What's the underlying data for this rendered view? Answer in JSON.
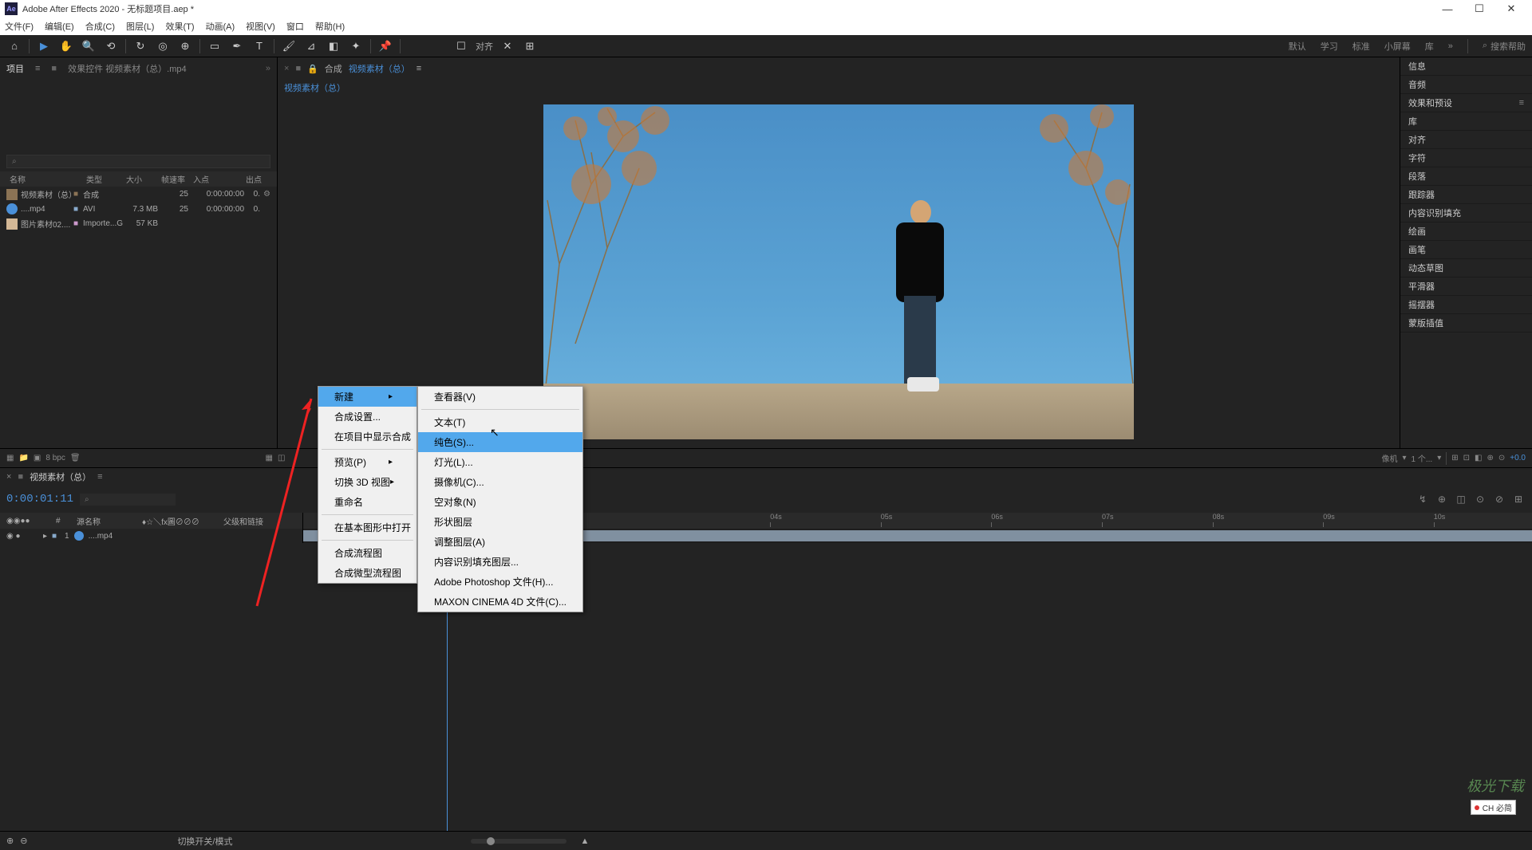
{
  "title": "Adobe After Effects 2020 - 无标题项目.aep *",
  "menu_bar": [
    "文件(F)",
    "编辑(E)",
    "合成(C)",
    "图层(L)",
    "效果(T)",
    "动画(A)",
    "视图(V)",
    "窗口",
    "帮助(H)"
  ],
  "toolbar": {
    "align_label": "对齐",
    "workspaces": [
      "默认",
      "学习",
      "标准",
      "小屏幕",
      "库"
    ],
    "search_placeholder": "搜索帮助"
  },
  "project": {
    "tab_project": "项目",
    "tab_effects": "效果控件 视频素材（总）.mp4",
    "search_icon": "⌕",
    "headers": {
      "name": "名称",
      "type": "类型",
      "size": "大小",
      "fps": "帧速率",
      "in": "入点",
      "out": "出点"
    },
    "rows": [
      {
        "name": "视频素材（总）",
        "type": "合成",
        "size": "",
        "fps": "25",
        "in": "0:00:00:00",
        "out": "0."
      },
      {
        "name": "....mp4",
        "type": "AVI",
        "size": "7.3 MB",
        "fps": "25",
        "in": "0:00:00:00",
        "out": "0."
      },
      {
        "name": "图片素材02....",
        "type": "Importe...G",
        "size": "57 KB",
        "fps": "",
        "in": "",
        "out": ""
      }
    ],
    "footer_bpc": "8 bpc"
  },
  "comp": {
    "label": "合成",
    "name": "视频素材（总）",
    "crumb": "视频素材（总）",
    "bottom": {
      "camera": "像机",
      "one": "1 个...",
      "val": "+0.0"
    }
  },
  "right_panels": [
    "信息",
    "音频",
    "效果和预设",
    "库",
    "对齐",
    "字符",
    "段落",
    "跟踪器",
    "内容识别填充",
    "绘画",
    "画笔",
    "动态草图",
    "平滑器",
    "摇摆器",
    "蒙版插值"
  ],
  "timeline": {
    "name": "视频素材（总）",
    "timecode": "0:00:01:11",
    "header_left": [
      "#",
      "源名称",
      "♦☆＼fx圖⊘⊘⊘",
      "父级和链接"
    ],
    "ticks": [
      "04s",
      "05s",
      "06s",
      "07s",
      "08s",
      "09s",
      "10s"
    ],
    "layer": {
      "index": "1",
      "name": "....mp4"
    },
    "footer_label": "切换开关/模式"
  },
  "context_menu1": {
    "items": [
      {
        "label": "新建",
        "arrow": true,
        "highlighted": true
      },
      {
        "label": "合成设置..."
      },
      {
        "label": "在项目中显示合成"
      },
      {
        "sep": true
      },
      {
        "label": "预览(P)",
        "arrow": true
      },
      {
        "label": "切换 3D 视图",
        "arrow": true
      },
      {
        "label": "重命名"
      },
      {
        "sep": true
      },
      {
        "label": "在基本图形中打开"
      },
      {
        "sep": true
      },
      {
        "label": "合成流程图"
      },
      {
        "label": "合成微型流程图"
      }
    ]
  },
  "context_menu2": {
    "items": [
      {
        "label": "查看器(V)"
      },
      {
        "sep": true
      },
      {
        "label": "文本(T)"
      },
      {
        "label": "纯色(S)...",
        "highlighted": true
      },
      {
        "label": "灯光(L)..."
      },
      {
        "label": "摄像机(C)..."
      },
      {
        "label": "空对象(N)"
      },
      {
        "label": "形状图层"
      },
      {
        "label": "调整图层(A)"
      },
      {
        "label": "内容识别填充图层..."
      },
      {
        "label": "Adobe Photoshop 文件(H)..."
      },
      {
        "label": "MAXON CINEMA 4D 文件(C)..."
      }
    ]
  },
  "ime_label": "CH 必简",
  "watermark": "极光下载"
}
